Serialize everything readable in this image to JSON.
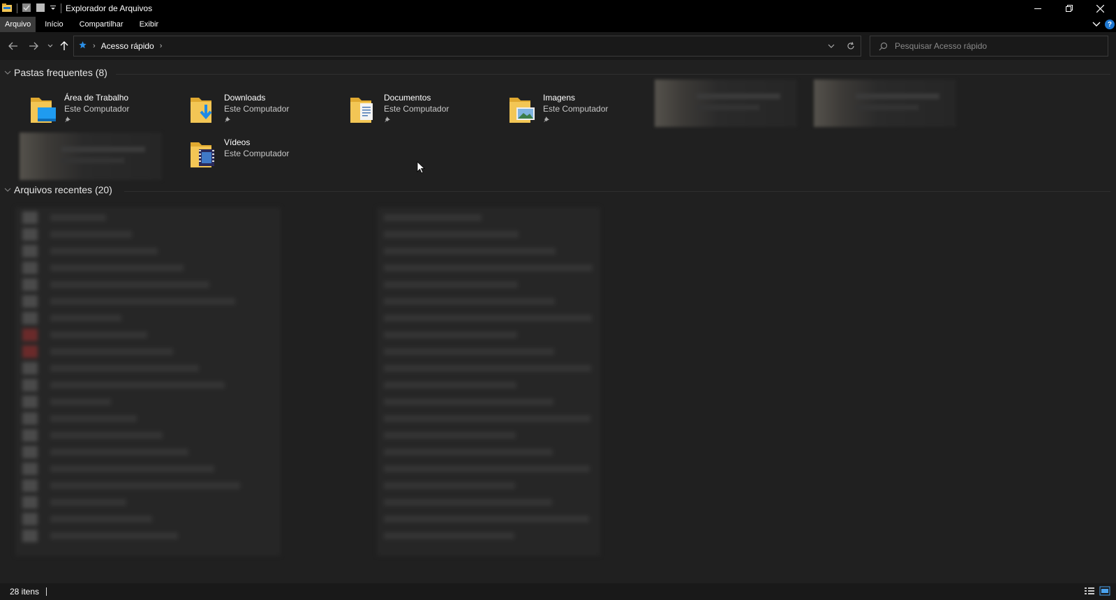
{
  "window": {
    "title": "Explorador de Arquivos"
  },
  "ribbon": {
    "tabs": [
      {
        "label": "Arquivo",
        "active": true
      },
      {
        "label": "Início"
      },
      {
        "label": "Compartilhar"
      },
      {
        "label": "Exibir"
      }
    ]
  },
  "address": {
    "crumbs": [
      "Acesso rápido"
    ]
  },
  "search": {
    "placeholder": "Pesquisar Acesso rápido"
  },
  "frequent": {
    "header": "Pastas frequentes (8)",
    "folders": [
      {
        "name": "Área de Trabalho",
        "location": "Este Computador",
        "icon": "desktop-folder-icon"
      },
      {
        "name": "Downloads",
        "location": "Este Computador",
        "icon": "downloads-folder-icon"
      },
      {
        "name": "Documentos",
        "location": "Este Computador",
        "icon": "documents-folder-icon"
      },
      {
        "name": "Imagens",
        "location": "Este Computador",
        "icon": "pictures-folder-icon"
      },
      {
        "name": "Vídeos",
        "location": "Este Computador",
        "icon": "videos-folder-icon"
      }
    ]
  },
  "recent": {
    "header": "Arquivos recentes (20)"
  },
  "status": {
    "items": "28 itens"
  },
  "colors": {
    "accent": "#1f78d1",
    "folder": "#f3c655",
    "background": "#202020"
  }
}
